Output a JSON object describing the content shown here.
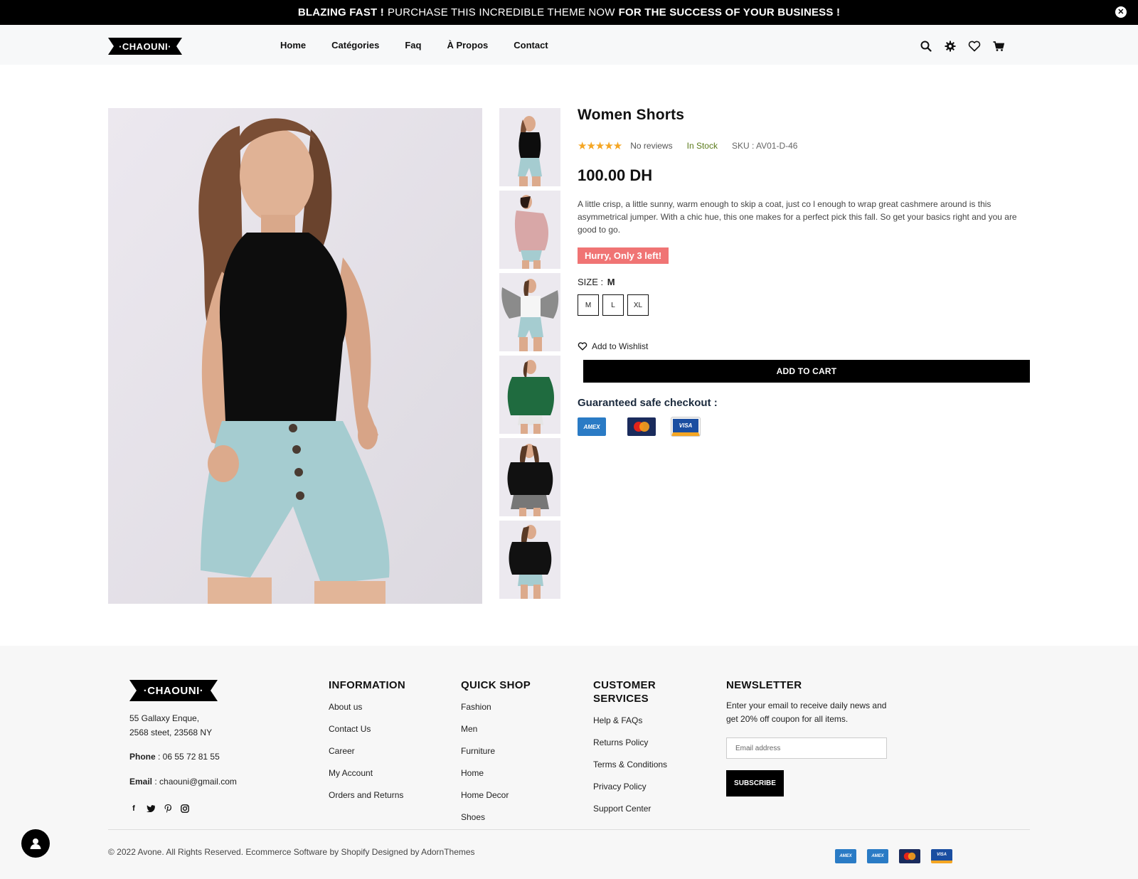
{
  "announcement": {
    "part1": "BLAZING FAST !",
    "part2": "PURCHASE THIS INCREDIBLE THEME NOW",
    "part3": "FOR THE SUCCESS OF YOUR BUSINESS !",
    "close_icon": "close-icon"
  },
  "brand": {
    "name": "·CHAOUNI·"
  },
  "nav": {
    "items": [
      {
        "label": "Home"
      },
      {
        "label": "Catégories"
      },
      {
        "label": "Faq"
      },
      {
        "label": "À Propos"
      },
      {
        "label": "Contact"
      }
    ]
  },
  "header_icons": [
    "search-icon",
    "gear-icon",
    "heart-icon",
    "cart-icon"
  ],
  "product": {
    "title": "Women Shorts",
    "reviews": "No reviews",
    "stock": "In Stock",
    "sku": "SKU : AV01-D-46",
    "price": "100.00 DH",
    "description": "A little crisp, a little sunny, warm enough to skip a coat, just co l enough to wrap great cashmere around is this asymmetrical jumper. With a chic hue, this one makes for a perfect pick this fall. So get your basics right and you are good to go.",
    "hurry": "Hurry, Only 3 left!",
    "size_label": "SIZE :",
    "selected_size": "M",
    "sizes": [
      "M",
      "L",
      "XL"
    ],
    "wishlist": "Add to Wishlist",
    "add_to_cart": "ADD TO CART",
    "safe_checkout": "Guaranteed safe checkout :",
    "payment_cards": [
      "AMEX",
      "MasterCard",
      "VISA"
    ]
  },
  "footer": {
    "address_line1": "55 Gallaxy Enque,",
    "address_line2": "2568 steet, 23568 NY",
    "phone_label": "Phone",
    "phone": " : 06 55 72 81 55",
    "email_label": "Email",
    "email": " : chaouni@gmail.com",
    "socials": [
      "facebook-icon",
      "twitter-icon",
      "pinterest-icon",
      "instagram-icon"
    ],
    "information": {
      "title": "INFORMATION",
      "links": [
        "About us",
        "Contact Us",
        "Career",
        "My Account",
        "Orders and Returns"
      ]
    },
    "quick_shop": {
      "title": "QUICK SHOP",
      "links": [
        "Fashion",
        "Men",
        "Furniture",
        "Home",
        "Home Decor",
        "Shoes"
      ]
    },
    "customer_services": {
      "title": "CUSTOMER SERVICES",
      "links": [
        "Help & FAQs",
        "Returns Policy",
        "Terms & Conditions",
        "Privacy Policy",
        "Support Center"
      ]
    },
    "newsletter": {
      "title": "NEWSLETTER",
      "text": "Enter your email to receive daily news and get 20% off coupon for all items.",
      "placeholder": "Email address",
      "button": "SUBSCRIBE"
    },
    "copyright": "© 2022 Avone. All Rights Reserved. Ecommerce Software by Shopify Designed by AdornThemes",
    "payment_cards": [
      "AMEX",
      "AMEX",
      "MasterCard",
      "VISA"
    ]
  },
  "colors": {
    "accent": "#000000",
    "hurry": "#f07474",
    "stars": "#f5a623",
    "instock": "#5a7a1a"
  }
}
